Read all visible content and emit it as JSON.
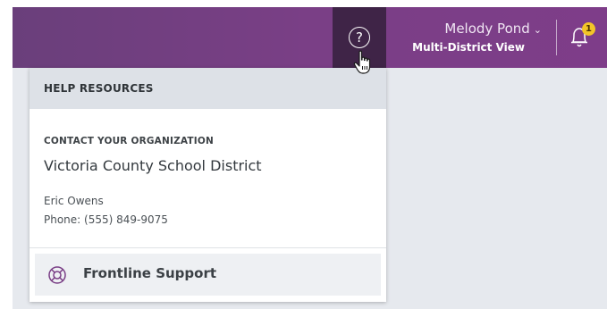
{
  "header": {
    "help_icon": "question-circle-icon",
    "user_name": "Melody Pond",
    "user_view": "Multi-District View",
    "notifications": {
      "icon": "bell-icon",
      "count": "1"
    }
  },
  "help_panel": {
    "title": "HELP RESOURCES",
    "contact_label": "CONTACT YOUR ORGANIZATION",
    "organization": "Victoria County School District",
    "contact_name": "Eric Owens",
    "contact_phone": "Phone: (555) 849-9075",
    "support_link": {
      "icon": "lifebuoy-icon",
      "label": "Frontline Support"
    }
  },
  "colors": {
    "topbar": "#7a3f86",
    "help_button_active": "#3f2447",
    "badge": "#f2c428"
  }
}
